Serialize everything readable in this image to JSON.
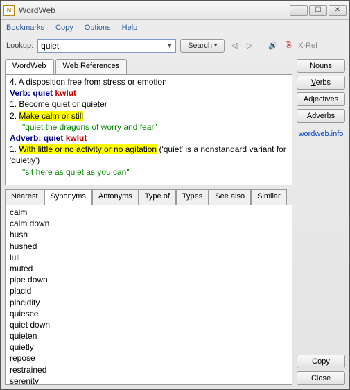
{
  "app": {
    "title": "WordWeb"
  },
  "menu": {
    "bookmarks": "Bookmarks",
    "copy": "Copy",
    "options": "Options",
    "help": "Help"
  },
  "toolbar": {
    "lookup_label": "Lookup:",
    "lookup_value": "quiet",
    "search_label": "Search",
    "xref_label": "X-Ref"
  },
  "tabs": {
    "wordweb": "WordWeb",
    "webrefs": "Web References"
  },
  "definitions": {
    "line4": "4. A disposition free from stress or emotion",
    "verb_label": "Verb:",
    "verb_word": "quiet",
    "verb_pron": "kwIut",
    "v1": "1. Become quiet or quieter",
    "v2_num": "2. ",
    "v2_hl": "Make calm or still",
    "v2_ex": "\"quiet the dragons of worry and fear\"",
    "adverb_label": "Adverb:",
    "adverb_word": "quiet",
    "adverb_pron": "kwIut",
    "a1_num": "1. ",
    "a1_hl": "With little or no activity or no agitation",
    "a1_rest": " ('quiet' is a nonstandard variant for 'quietly')",
    "a1_ex": "\"sit here as quiet as you can\""
  },
  "subtabs": {
    "nearest": "Nearest",
    "synonyms": "Synonyms",
    "antonyms": "Antonyms",
    "typeof": "Type of",
    "types": "Types",
    "seealso": "See also",
    "similar": "Similar"
  },
  "synonyms": [
    "calm",
    "calm down",
    "hush",
    "hushed",
    "lull",
    "muted",
    "pipe down",
    "placid",
    "placidity",
    "quiesce",
    "quiet down",
    "quieten",
    "quietly",
    "repose",
    "restrained",
    "serenity"
  ],
  "sidebar": {
    "nouns": "Nouns",
    "verbs": "Verbs",
    "adjectives": "Adjectives",
    "adverbs": "Adverbs",
    "link": "wordweb.info",
    "copy": "Copy",
    "close": "Close"
  }
}
